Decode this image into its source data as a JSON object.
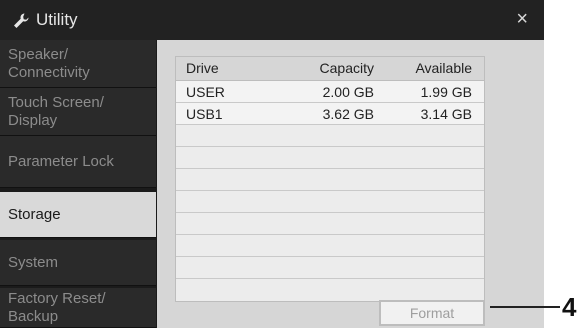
{
  "window": {
    "title": "Utility",
    "icon": "wrench-icon",
    "close_glyph": "×"
  },
  "sidebar": {
    "items": [
      {
        "line1": "Speaker/",
        "line2": "Connectivity",
        "active": false
      },
      {
        "line1": "Touch Screen/",
        "line2": "Display",
        "active": false
      },
      {
        "line1": "Parameter Lock",
        "line2": "",
        "active": false
      },
      {
        "line1": "Storage",
        "line2": "",
        "active": true
      },
      {
        "line1": "System",
        "line2": "",
        "active": false
      },
      {
        "line1": "Factory Reset/",
        "line2": "Backup",
        "active": false
      }
    ]
  },
  "storage": {
    "columns": [
      "Drive",
      "Capacity",
      "Available"
    ],
    "rows": [
      {
        "drive": "USER",
        "capacity": "2.00 GB",
        "available": "1.99 GB"
      },
      {
        "drive": "USB1",
        "capacity": "3.62 GB",
        "available": "3.14 GB"
      }
    ],
    "format_label": "Format"
  },
  "callout": {
    "number": "4"
  },
  "colors": {
    "window_bg": "#1b1b1b",
    "panel_bg": "#d6d6d6",
    "active_tab": "#d9d9d9"
  }
}
